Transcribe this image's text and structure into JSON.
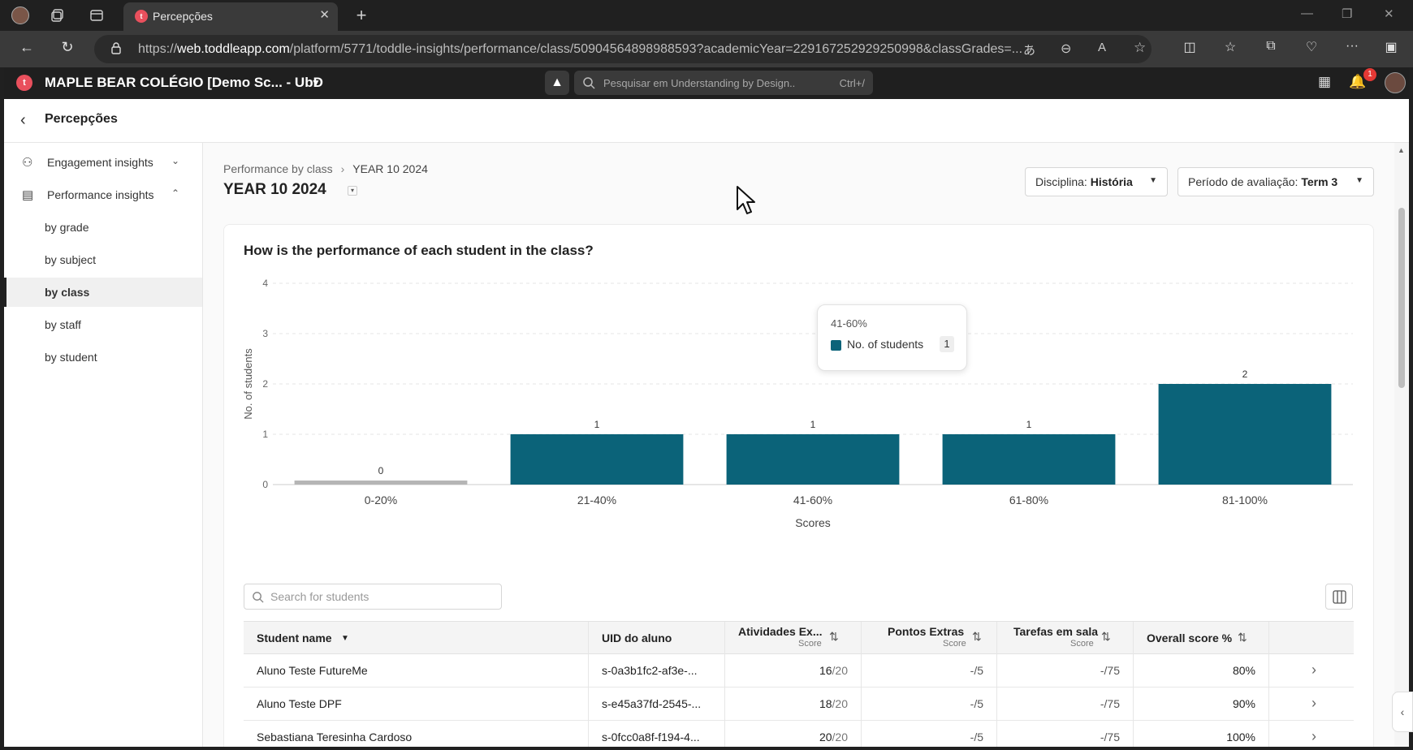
{
  "browser": {
    "tab_title": "Percepções",
    "url_prefix": "https://",
    "url_host": "web.toddleapp.com",
    "url_path": "/platform/5771/toddle-insights/performance/class/50904564898988593?academicYear=229167252929250998&classGrades=..."
  },
  "app": {
    "school_name": "MAPLE BEAR COLÉGIO [Demo Sc... - UbD",
    "search_placeholder": "Pesquisar em Understanding by Design..",
    "search_shortcut": "Ctrl+/",
    "notification_count": "1"
  },
  "page": {
    "title": "Percepções"
  },
  "sidebar": {
    "groups": [
      {
        "label": "Engagement insights"
      },
      {
        "label": "Performance insights"
      }
    ],
    "items": [
      {
        "label": "by grade"
      },
      {
        "label": "by subject"
      },
      {
        "label": "by class"
      },
      {
        "label": "by staff"
      },
      {
        "label": "by student"
      }
    ]
  },
  "main": {
    "breadcrumb_parent": "Performance by class",
    "breadcrumb_current": "YEAR 10 2024",
    "title": "YEAR 10 2024",
    "filter_subject_label": "Disciplina:",
    "filter_subject_value": "História",
    "filter_period_label": "Período de avaliação:",
    "filter_period_value": "Term 3"
  },
  "card": {
    "title": "How is the performance of each student in the class?"
  },
  "tooltip": {
    "header": "41-60%",
    "label": "No. of students",
    "value": "1"
  },
  "colors": {
    "bar": "#0b6379",
    "bar_zero": "#b5b5b5"
  },
  "chart_data": {
    "type": "bar",
    "categories": [
      "0-20%",
      "21-40%",
      "41-60%",
      "61-80%",
      "81-100%"
    ],
    "values": [
      0,
      1,
      1,
      1,
      2
    ],
    "xlabel": "Scores",
    "ylabel": "No. of students",
    "ylim": [
      0,
      4
    ],
    "yticks": [
      0,
      1,
      2,
      3,
      4
    ],
    "grid": true
  },
  "table": {
    "search_placeholder": "Search for students",
    "headers": {
      "name": "Student name",
      "uid": "UID do aluno",
      "c1": "Atividades Ex...",
      "c2": "Pontos Extras",
      "c3": "Tarefas em sala",
      "score_sub": "Score",
      "overall": "Overall score %"
    },
    "rows": [
      {
        "name": "Aluno Teste FutureMe",
        "uid": "s-0a3b1fc2-af3e-...",
        "c1": "16",
        "c1_max": "/20",
        "c2": "-/5",
        "c3": "-/75",
        "overall": "80%"
      },
      {
        "name": "Aluno Teste DPF",
        "uid": "s-e45a37fd-2545-...",
        "c1": "18",
        "c1_max": "/20",
        "c2": "-/5",
        "c3": "-/75",
        "overall": "90%"
      },
      {
        "name": "Sebastiana Teresinha Cardoso",
        "uid": "s-0fcc0a8f-f194-4...",
        "c1": "20",
        "c1_max": "/20",
        "c2": "-/5",
        "c3": "-/75",
        "overall": "100%"
      }
    ]
  }
}
